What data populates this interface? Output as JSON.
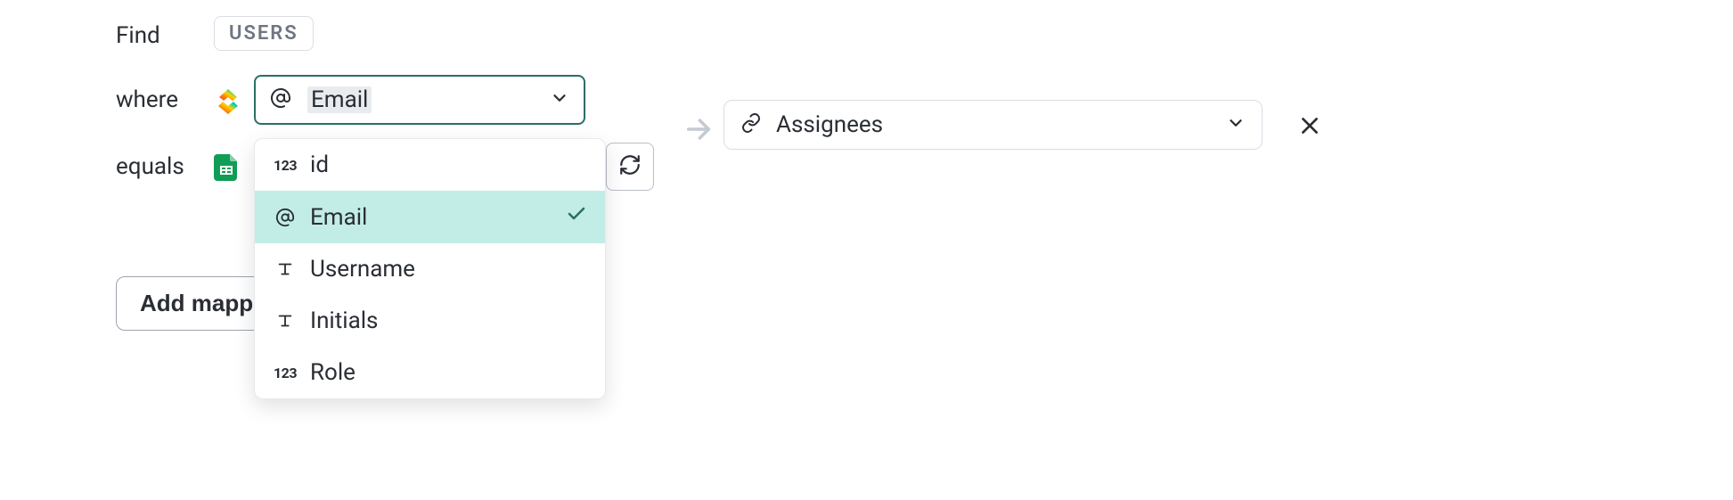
{
  "labels": {
    "find": "Find",
    "where": "where",
    "equals": "equals"
  },
  "tag": {
    "users": "USERS"
  },
  "where_field": {
    "icon": "at",
    "selected": "Email"
  },
  "dropdown": {
    "options": [
      {
        "icon": "number",
        "label": "id",
        "selected": false
      },
      {
        "icon": "at",
        "label": "Email",
        "selected": true
      },
      {
        "icon": "text",
        "label": "Username",
        "selected": false
      },
      {
        "icon": "text",
        "label": "Initials",
        "selected": false
      },
      {
        "icon": "number",
        "label": "Role",
        "selected": false
      }
    ]
  },
  "equals_field": {
    "source_icon": "google-sheets"
  },
  "target_field": {
    "icon": "link",
    "label": "Assignees"
  },
  "buttons": {
    "add_mapping": "Add mapping",
    "refresh": "refresh",
    "remove": "remove"
  },
  "icons": {
    "number_glyph": "123"
  }
}
